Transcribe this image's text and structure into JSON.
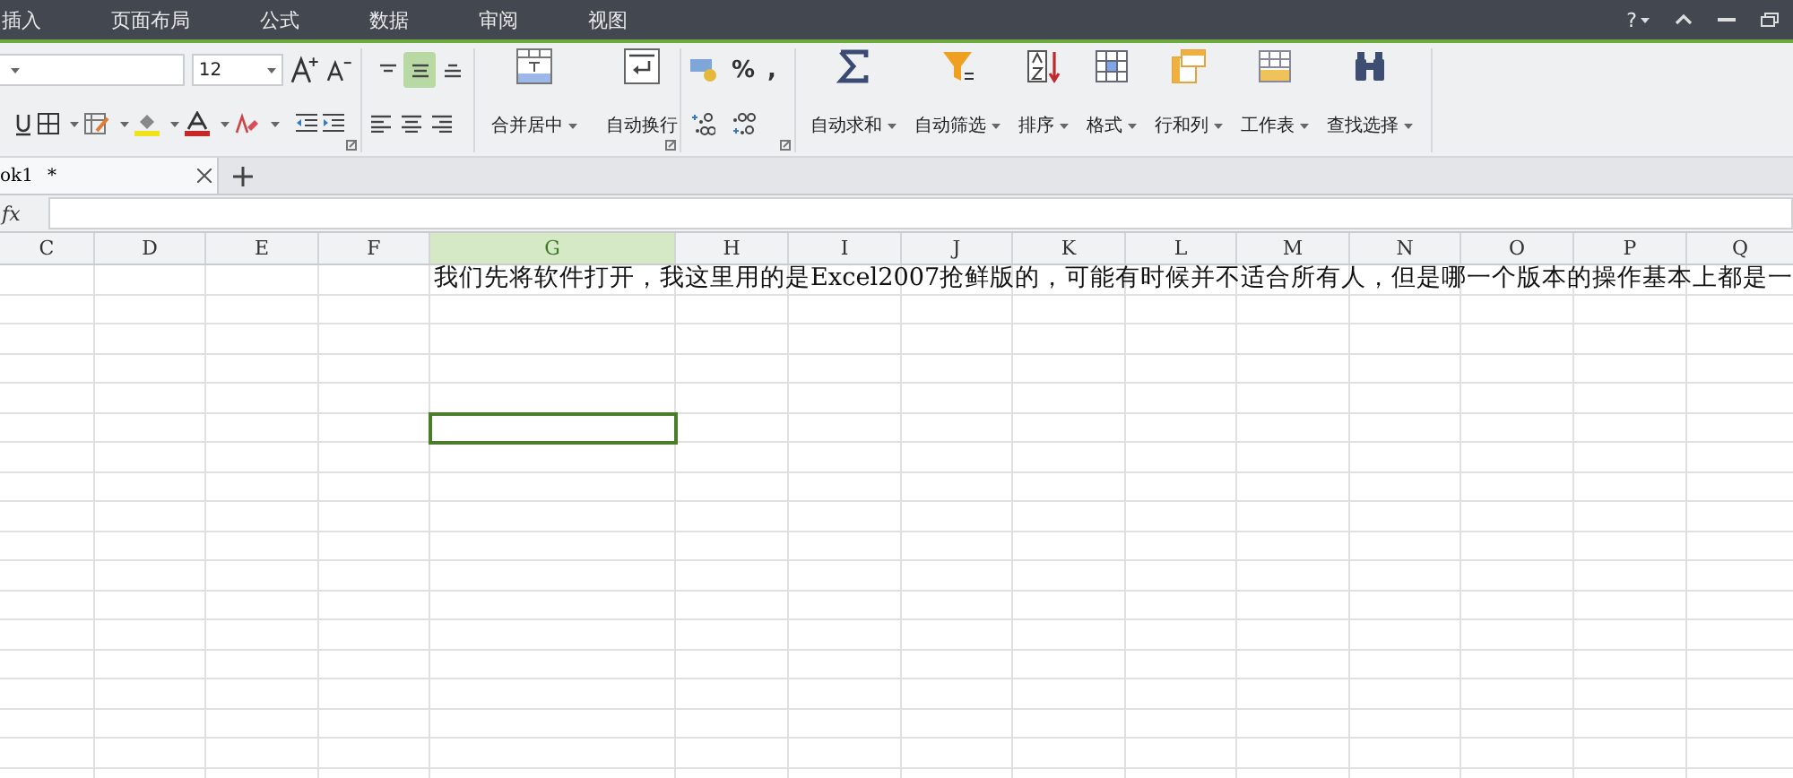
{
  "menu": [
    {
      "label": "插入",
      "selected": false
    },
    {
      "label": "页面布局",
      "selected": false
    },
    {
      "label": "公式",
      "selected": false
    },
    {
      "label": "数据",
      "selected": false
    },
    {
      "label": "审阅",
      "selected": false
    },
    {
      "label": "视图",
      "selected": false
    }
  ],
  "help_button": "?",
  "ribbon": {
    "font_size": "12",
    "vertical_align": [
      {
        "selected": false
      },
      {
        "selected": true
      },
      {
        "selected": false
      }
    ],
    "merge_button": "合并居中",
    "wrap_button": "自动换行",
    "percent_button": "%",
    "comma_button": ",",
    "tools": [
      {
        "kind": "sum",
        "label": "自动求和"
      },
      {
        "kind": "filter",
        "label": "自动筛选"
      },
      {
        "kind": "sort",
        "label": "排序"
      },
      {
        "kind": "format",
        "label": "格式"
      },
      {
        "kind": "rowcol",
        "label": "行和列"
      },
      {
        "kind": "sheet",
        "label": "工作表"
      },
      {
        "kind": "find",
        "label": "查找选择"
      }
    ]
  },
  "tabs": [
    {
      "label": "ok1",
      "mark": "*",
      "selected": true
    }
  ],
  "formula_bar": {
    "label": "fx"
  },
  "sheet": {
    "columns": [
      {
        "label": "C",
        "selected": false
      },
      {
        "label": "D",
        "selected": false
      },
      {
        "label": "E",
        "selected": false
      },
      {
        "label": "F",
        "selected": false
      },
      {
        "label": "G",
        "selected": true
      },
      {
        "label": "H",
        "selected": false
      },
      {
        "label": "I",
        "selected": false
      },
      {
        "label": "J",
        "selected": false
      },
      {
        "label": "K",
        "selected": false
      },
      {
        "label": "L",
        "selected": false
      },
      {
        "label": "M",
        "selected": false
      },
      {
        "label": "N",
        "selected": false
      },
      {
        "label": "O",
        "selected": false
      },
      {
        "label": "P",
        "selected": false
      },
      {
        "label": "Q",
        "selected": false
      }
    ],
    "rows": [
      {
        "text": "我们先将软件打开，我这里用的是Excel2007抢鲜版的，可能有时候并不适合所有人，但是哪一个版本的操作基本上都是一",
        "selected": false
      },
      {
        "selected": false
      },
      {
        "selected": false
      },
      {
        "selected": false
      },
      {
        "selected": false
      },
      {
        "selected": true
      },
      {
        "selected": false
      },
      {
        "selected": false
      },
      {
        "selected": false
      },
      {
        "selected": false
      },
      {
        "selected": false
      },
      {
        "selected": false
      },
      {
        "selected": false
      },
      {
        "selected": false
      },
      {
        "selected": false
      },
      {
        "selected": false
      },
      {
        "selected": false
      },
      {
        "selected": false
      }
    ]
  }
}
